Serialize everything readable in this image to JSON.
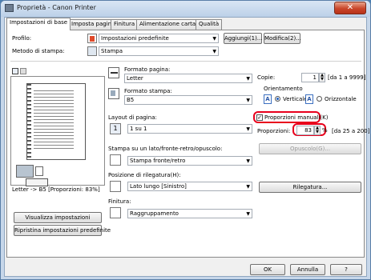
{
  "window": {
    "title": "Proprietà - Canon Printer",
    "close": "✕"
  },
  "tabs": [
    "Impostazioni di base",
    "Imposta pagina",
    "Finitura",
    "Alimentazione carta",
    "Qualità"
  ],
  "profile": {
    "label": "Profilo:",
    "value": "Impostazioni predefinite",
    "add": "Aggiungi(1)...",
    "modify": "Modifica(2)..."
  },
  "output": {
    "label": "Metodo di stampa:",
    "value": "Stampa"
  },
  "preview": {
    "caption": "Letter -> B5 [Proporzioni: 83%]",
    "view_settings": "Visualizza impostazioni",
    "restore": "Ripristina impostazioni predefinite"
  },
  "page_size": {
    "label": "Formato pagina:",
    "value": "Letter"
  },
  "output_size": {
    "label": "Formato stampa:",
    "value": "B5"
  },
  "copies": {
    "label": "Copie:",
    "value": "1",
    "range": "[da 1 a 9999]"
  },
  "orientation": {
    "label": "Orientamento",
    "portrait": "Verticale",
    "landscape": "Orizzontale",
    "portrait_glyph": "A",
    "landscape_glyph": "A"
  },
  "manual_scaling": {
    "label": "Proporzioni manuali(K)",
    "checked": "✓"
  },
  "scaling": {
    "label": "Proporzioni:",
    "value": "83",
    "unit": "%",
    "range": "[da 25 a 200]"
  },
  "layout": {
    "label": "Layout di pagina:",
    "value": "1 su 1",
    "glyph": "1"
  },
  "watermark_btn": "Opuscolo(G)...",
  "print_style": {
    "label": "Stampa su un lato/fronte-retro/opuscolo:",
    "value": "Stampa fronte/retro"
  },
  "binding": {
    "label": "Posizione di rilegatura(H):",
    "value": "Lato lungo [Sinistro]",
    "button": "Rilegatura..."
  },
  "finishing": {
    "label": "Finitura:",
    "value": "Raggruppamento"
  },
  "footer": {
    "ok": "OK",
    "cancel": "Annulla",
    "help": "?"
  }
}
